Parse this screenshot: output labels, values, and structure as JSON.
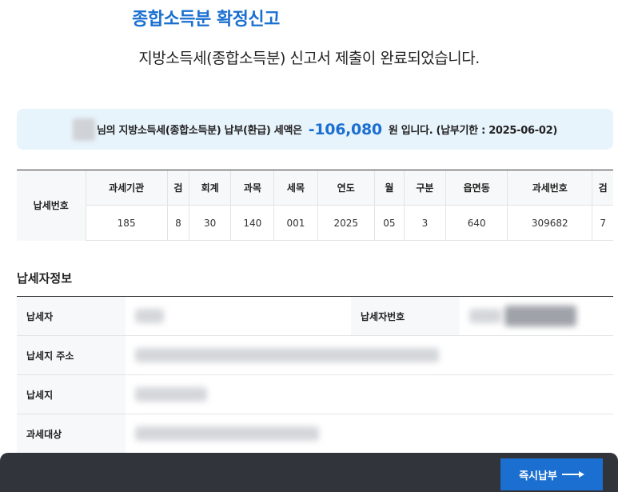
{
  "header": {
    "title": "종합소득분 확정신고",
    "subtitle": "지방소득세(종합소득분) 신고서 제출이 완료되었습니다."
  },
  "summary": {
    "prefix": "님의 지방소득세(종합소득분) 납부(환급) 세액은",
    "amount": "-106,080",
    "suffix": "원 입니다. (납부기한 : 2025-06-02)"
  },
  "tax_number_table": {
    "row_label": "납세번호",
    "headers": [
      "과세기관",
      "검",
      "회계",
      "과목",
      "세목",
      "연도",
      "월",
      "구분",
      "읍면동",
      "과세번호",
      "검"
    ],
    "values": [
      "185",
      "8",
      "30",
      "140",
      "001",
      "2025",
      "05",
      "3",
      "640",
      "309682",
      "7"
    ]
  },
  "taxpayer_info": {
    "section_title": "납세자정보",
    "taxpayer_label": "납세자",
    "taxpayer_id_label": "납세자번호",
    "address_label": "납세지 주소",
    "tax_location_label": "납세지",
    "target_label": "과세대상"
  },
  "actions": {
    "pay_now": "즉시납부"
  },
  "colors": {
    "accent": "#1a6fd0",
    "summary_bg": "#e8f4fc",
    "bottom_bar": "#31343b"
  }
}
